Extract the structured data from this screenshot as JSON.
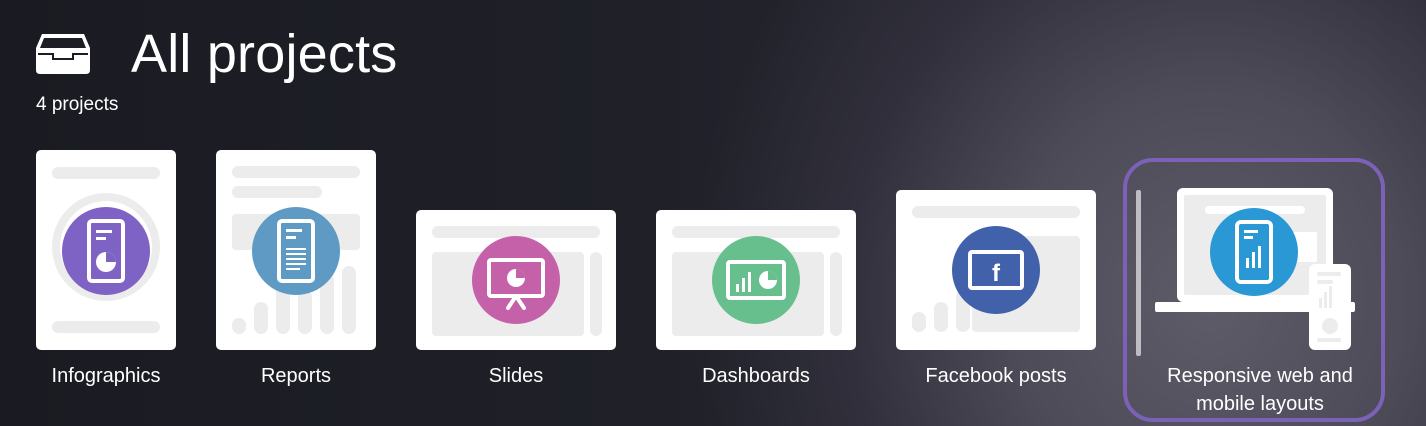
{
  "header": {
    "icon": "inbox-tray-icon",
    "title": "All projects",
    "count_label": "4 projects"
  },
  "colors": {
    "infographics": "#7e63c4",
    "reports": "#5e9ac4",
    "slides": "#c461a8",
    "dashboards": "#68bf8e",
    "facebook": "#4161ab",
    "responsive": "#2b98d6",
    "selected_outline": "#7b62b8"
  },
  "project_types": [
    {
      "label": "Infographics",
      "icon": "infographic-icon"
    },
    {
      "label": "Reports",
      "icon": "report-document-icon"
    },
    {
      "label": "Slides",
      "icon": "presentation-easel-icon"
    },
    {
      "label": "Dashboards",
      "icon": "dashboard-chart-icon"
    },
    {
      "label": "Facebook posts",
      "icon": "facebook-icon"
    },
    {
      "label": "Responsive web and mobile layouts",
      "label_line1": "Responsive web and",
      "label_line2": "mobile layouts",
      "icon": "responsive-device-icon",
      "selected": true
    }
  ]
}
